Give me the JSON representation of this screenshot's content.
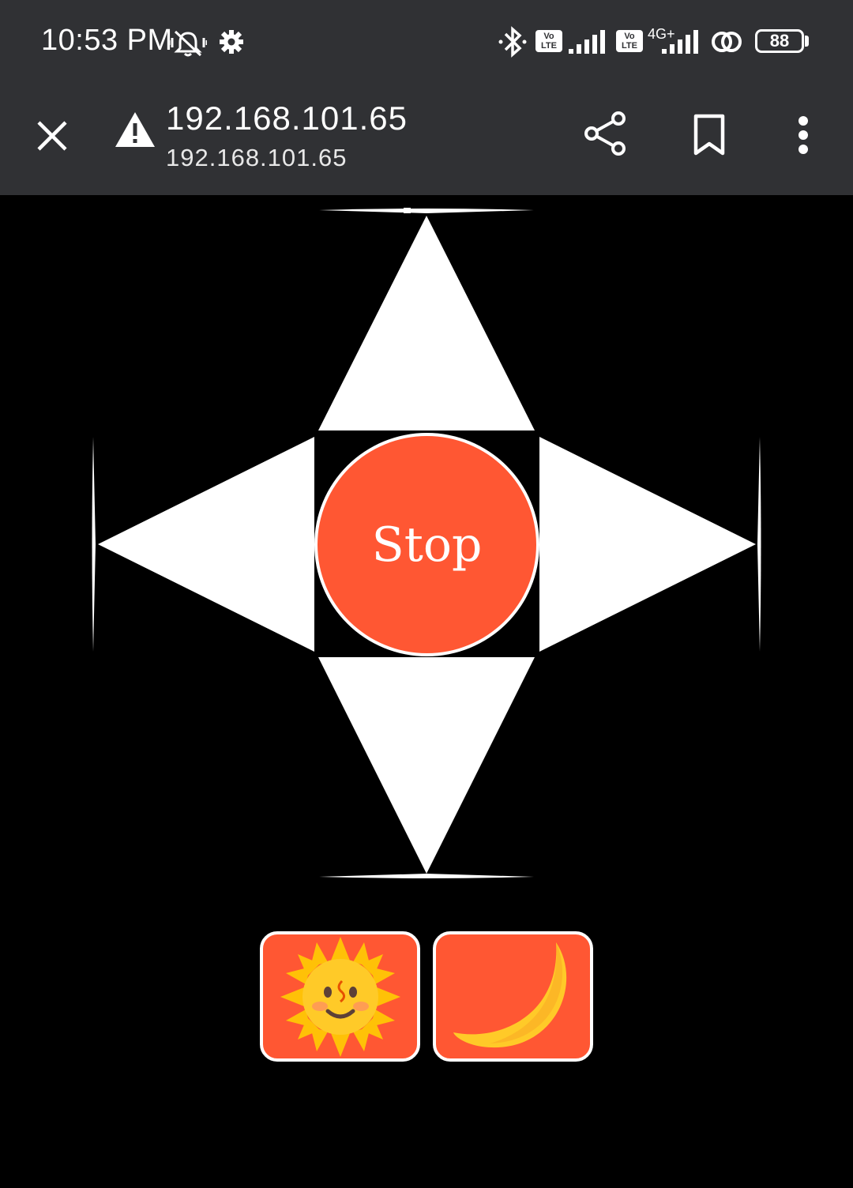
{
  "status_bar": {
    "time": "10:53 PM",
    "lte_badge_1": "Vo LTE",
    "lte_badge_2": "Vo LTE",
    "network_type": "4G+",
    "battery_level": "88",
    "icons": [
      "vibrate-mute-icon",
      "gear-icon",
      "bluetooth-icon",
      "signal-icon",
      "signal-icon",
      "sync-icon",
      "battery-icon"
    ]
  },
  "toolbar": {
    "url_title": "192.168.101.65",
    "url_subtitle": "192.168.101.65",
    "icons": [
      "close-icon",
      "warning-icon",
      "share-icon",
      "bookmark-icon",
      "more-vert-icon"
    ]
  },
  "controls": {
    "stop_label": "Stop",
    "buttons": [
      "arrow-up",
      "arrow-left",
      "arrow-right",
      "arrow-down",
      "stop",
      "day-mode",
      "night-mode"
    ],
    "accent_color": "#FF5733",
    "day_icon": "sun-with-face-icon",
    "night_icon": "crescent-moon-icon"
  }
}
